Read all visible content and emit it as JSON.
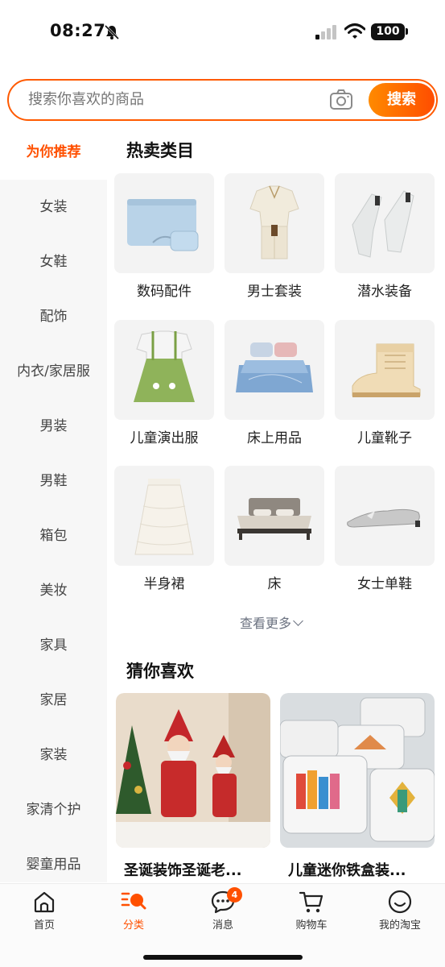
{
  "status_bar": {
    "time": "08:27",
    "battery": "100"
  },
  "search": {
    "placeholder": "搜索你喜欢的商品",
    "button_label": "搜索"
  },
  "sidebar": {
    "items": [
      {
        "label": "为你推荐",
        "active": true
      },
      {
        "label": "女装"
      },
      {
        "label": "女鞋"
      },
      {
        "label": "配饰"
      },
      {
        "label": "内衣/家居服"
      },
      {
        "label": "男装"
      },
      {
        "label": "男鞋"
      },
      {
        "label": "箱包"
      },
      {
        "label": "美妆"
      },
      {
        "label": "家具"
      },
      {
        "label": "家居"
      },
      {
        "label": "家装"
      },
      {
        "label": "家清个护"
      },
      {
        "label": "婴童用品"
      }
    ]
  },
  "hot": {
    "title": "热卖类目",
    "categories": [
      {
        "label": "数码配件",
        "icon": "laptop-sleeve-image"
      },
      {
        "label": "男士套装",
        "icon": "mens-suit-image"
      },
      {
        "label": "潜水装备",
        "icon": "diving-fins-image"
      },
      {
        "label": "儿童演出服",
        "icon": "kids-dress-image"
      },
      {
        "label": "床上用品",
        "icon": "bedding-image"
      },
      {
        "label": "儿童靴子",
        "icon": "kids-boot-image"
      },
      {
        "label": "半身裙",
        "icon": "skirt-image"
      },
      {
        "label": "床",
        "icon": "bed-image"
      },
      {
        "label": "女士单鞋",
        "icon": "flat-shoe-image"
      }
    ],
    "more_label": "查看更多"
  },
  "guess": {
    "title": "猜你喜欢",
    "items": [
      {
        "title": "圣诞装饰圣诞老...",
        "icon": "santa-decor-image"
      },
      {
        "title": "儿童迷你铁盒装...",
        "icon": "tin-box-toy-image"
      }
    ]
  },
  "tabbar": {
    "tabs": [
      {
        "label": "首页",
        "icon": "home-icon"
      },
      {
        "label": "分类",
        "icon": "category-icon",
        "active": true
      },
      {
        "label": "消息",
        "icon": "message-icon",
        "badge": "4"
      },
      {
        "label": "购物车",
        "icon": "cart-icon"
      },
      {
        "label": "我的淘宝",
        "icon": "profile-icon"
      }
    ]
  },
  "colors": {
    "accent": "#ff5000",
    "sidebar_bg": "#f7f7f7"
  }
}
